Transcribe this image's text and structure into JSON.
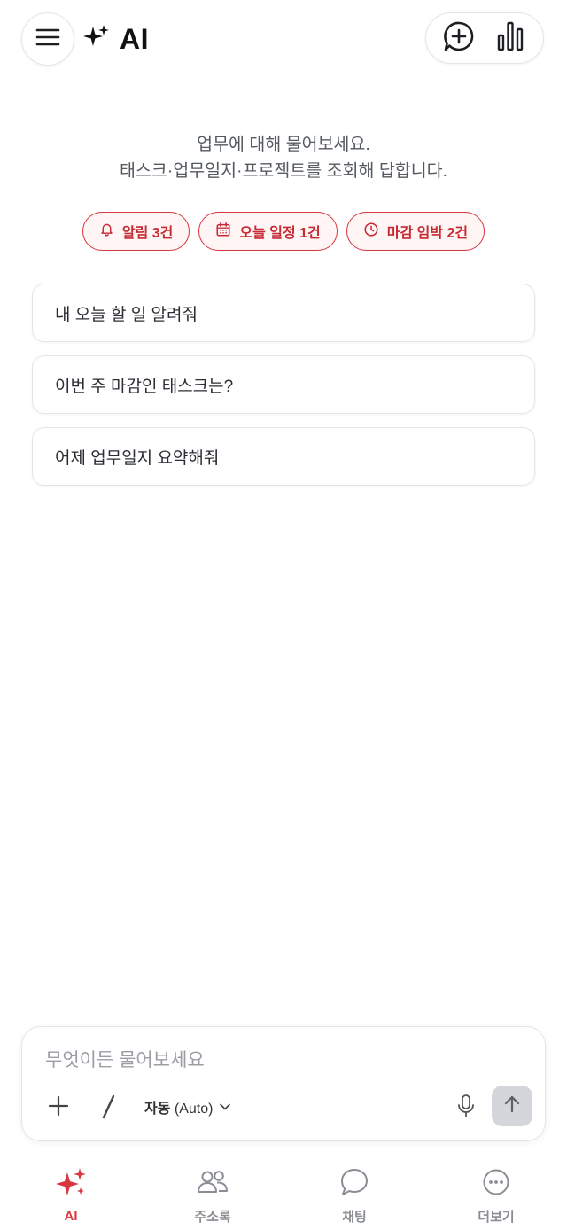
{
  "header": {
    "title": "AI",
    "menu_icon": "hamburger-menu-icon",
    "brand_icon": "sparkle-icon",
    "actions": [
      {
        "icon": "new-chat-plus-bubble-icon"
      },
      {
        "icon": "bar-chart-icon"
      }
    ]
  },
  "intro": {
    "line1": "업무에 대해 물어보세요.",
    "line2": "태스크·업무일지·프로젝트를 조회해 답합니다."
  },
  "chips": [
    {
      "icon": "bell-icon",
      "label": "알림 3건"
    },
    {
      "icon": "calendar-icon",
      "label": "오늘 일정 1건"
    },
    {
      "icon": "clock-icon",
      "label": "마감 임박 2건"
    }
  ],
  "suggestions": [
    "내 오늘 할 일 알려줘",
    "이번 주 마감인 태스크는?",
    "어제 업무일지 요약해줘"
  ],
  "composer": {
    "placeholder": "무엇이든 물어보세요",
    "value": "",
    "add_label": "+",
    "slash_label": "/",
    "mode_label": "자동",
    "mode_value": "(Auto)"
  },
  "bottom_nav": [
    {
      "label": "AI",
      "icon": "sparkle-icon",
      "active": true
    },
    {
      "label": "주소록",
      "icon": "contacts-icon",
      "active": false
    },
    {
      "label": "채팅",
      "icon": "chat-bubble-icon",
      "active": false
    },
    {
      "label": "더보기",
      "icon": "more-dots-icon",
      "active": false
    }
  ],
  "colors": {
    "accent": "#d7373f",
    "chip_bg": "#fff5f5",
    "send_disabled": "#d3d6da",
    "text_muted": "#8a8e94"
  }
}
